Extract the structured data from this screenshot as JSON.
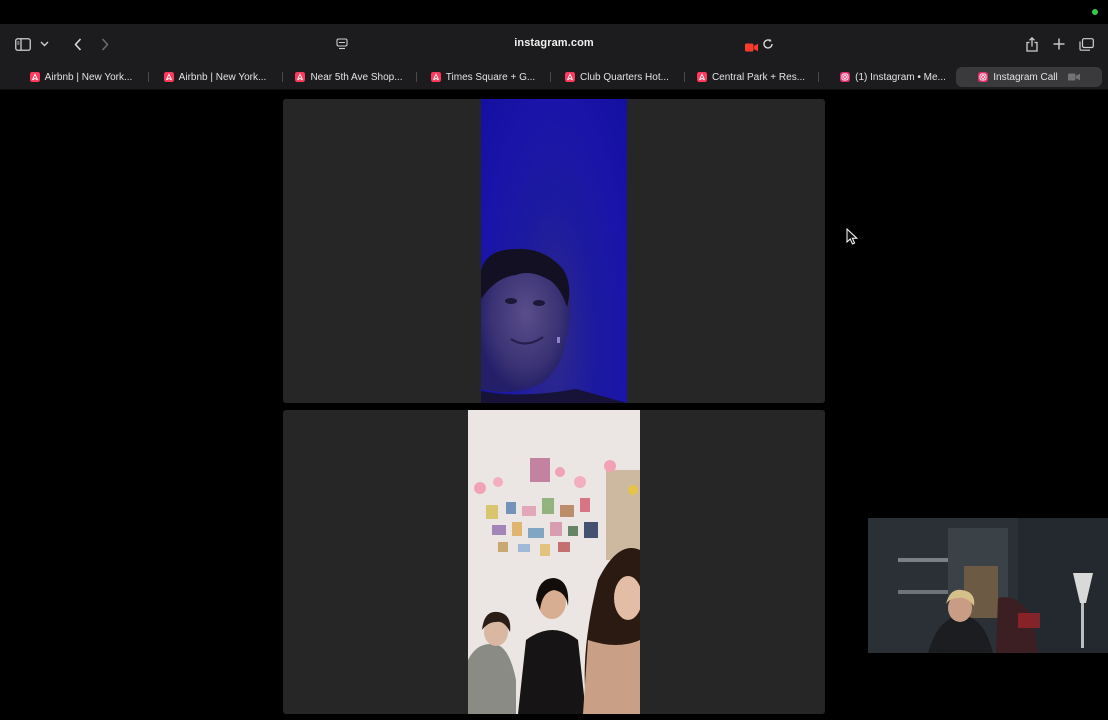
{
  "browser": {
    "url": "instagram.com",
    "tabs": [
      {
        "label": "Airbnb | New York...",
        "favicon": "airbnb-icon",
        "active": false
      },
      {
        "label": "Airbnb | New York...",
        "favicon": "airbnb-icon",
        "active": false
      },
      {
        "label": "Near 5th Ave Shop...",
        "favicon": "airbnb-icon",
        "active": false
      },
      {
        "label": "Times Square + G...",
        "favicon": "airbnb-icon",
        "active": false
      },
      {
        "label": "Club Quarters Hot...",
        "favicon": "airbnb-icon",
        "active": false
      },
      {
        "label": "Central Park + Res...",
        "favicon": "airbnb-icon",
        "active": false
      },
      {
        "label": "(1) Instagram • Me...",
        "favicon": "instagram-icon",
        "active": false
      },
      {
        "label": "Instagram Call",
        "favicon": "instagram-icon",
        "active": true
      }
    ]
  },
  "colors": {
    "airbnb": "#ff385c",
    "instagram": "#e1306c",
    "recording": "#ff3b30",
    "status_dot": "#37c84a"
  },
  "call": {
    "participants": [
      {
        "name": "participant-1",
        "background": "blue-lit room"
      },
      {
        "name": "participant-2",
        "background": "dorm room wall with photos"
      }
    ],
    "self_view": true
  }
}
